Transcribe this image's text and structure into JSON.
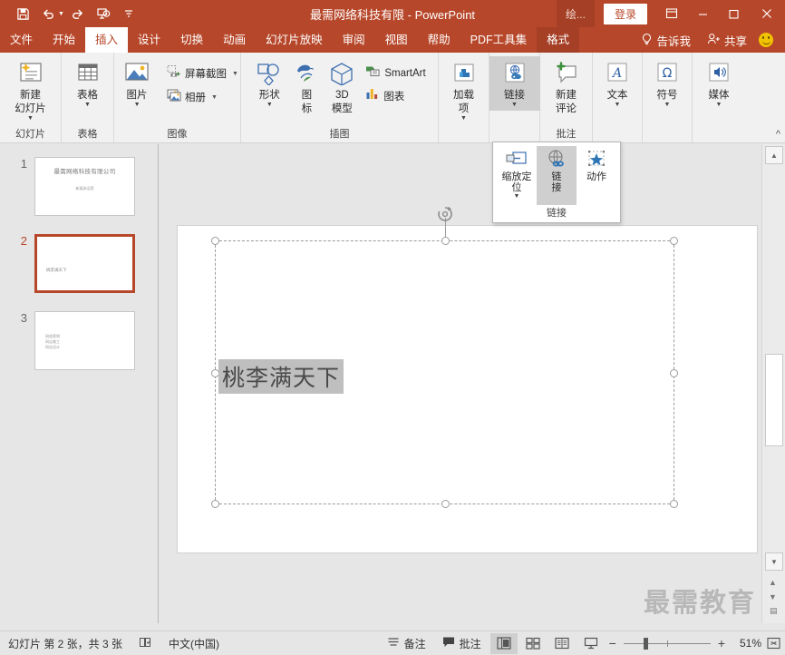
{
  "titlebar": {
    "document_title": "最需网络科技有限",
    "app_name": "PowerPoint",
    "separator": "-",
    "quick_access": [
      {
        "name": "save-icon",
        "label": "保存"
      },
      {
        "name": "undo-icon",
        "label": "撤消"
      },
      {
        "name": "redo-icon",
        "label": "恢复"
      },
      {
        "name": "start-slideshow-icon",
        "label": "从头开始"
      },
      {
        "name": "customize-qat-icon",
        "label": "自定义快速访问工具栏"
      }
    ],
    "draw_tab": "绘...",
    "signin": "登录",
    "ribbon_display": "功能区显示选项",
    "minimize": "最小化",
    "maximize": "最大化",
    "close": "关闭"
  },
  "tabs": [
    {
      "label": "文件",
      "active": false
    },
    {
      "label": "开始",
      "active": false
    },
    {
      "label": "插入",
      "active": true
    },
    {
      "label": "设计",
      "active": false
    },
    {
      "label": "切换",
      "active": false
    },
    {
      "label": "动画",
      "active": false
    },
    {
      "label": "幻灯片放映",
      "active": false
    },
    {
      "label": "审阅",
      "active": false
    },
    {
      "label": "视图",
      "active": false
    },
    {
      "label": "帮助",
      "active": false
    },
    {
      "label": "PDF工具集",
      "active": false
    },
    {
      "label": "格式",
      "active": false,
      "contextual": true
    }
  ],
  "tab_right": {
    "tellme": "告诉我",
    "share": "共享"
  },
  "ribbon": {
    "groups": [
      {
        "label": "幻灯片",
        "buttons": [
          {
            "label_line1": "新建",
            "label_line2": "幻灯片",
            "icon": "new-slide-icon",
            "dropdown": true
          }
        ]
      },
      {
        "label": "表格",
        "buttons": [
          {
            "label_line1": "表格",
            "label_line2": "",
            "icon": "table-icon",
            "dropdown": true
          }
        ]
      },
      {
        "label": "图像",
        "buttons": [
          {
            "label_line1": "图片",
            "label_line2": "",
            "icon": "picture-icon",
            "dropdown": true
          }
        ],
        "small_buttons": [
          {
            "label": "屏幕截图",
            "icon": "screenshot-icon",
            "dropdown": true
          },
          {
            "label": "相册",
            "icon": "photo-album-icon",
            "dropdown": true
          }
        ]
      },
      {
        "label": "插图",
        "buttons": [
          {
            "label_line1": "形状",
            "label_line2": "",
            "icon": "shapes-icon",
            "dropdown": true
          },
          {
            "label_line1": "图",
            "label_line2": "标",
            "icon": "icons-icon",
            "dropdown": false
          },
          {
            "label_line1": "3D",
            "label_line2": "模型",
            "icon": "model3d-icon",
            "dropdown": false
          }
        ],
        "small_buttons": [
          {
            "label": "SmartArt",
            "icon": "smartart-icon",
            "dropdown": false
          },
          {
            "label": "图表",
            "icon": "chart-icon",
            "dropdown": false
          }
        ]
      },
      {
        "label": "",
        "buttons": [
          {
            "label_line1": "加载",
            "label_line2": "项",
            "icon": "addins-icon",
            "dropdown": true
          }
        ]
      },
      {
        "label": "",
        "buttons": [
          {
            "label_line1": "链接",
            "label_line2": "",
            "icon": "link-icon",
            "dropdown": true,
            "active": true
          }
        ]
      },
      {
        "label": "批注",
        "buttons": [
          {
            "label_line1": "新建",
            "label_line2": "评论",
            "icon": "new-comment-icon",
            "dropdown": false
          }
        ]
      },
      {
        "label": "",
        "buttons": [
          {
            "label_line1": "文本",
            "label_line2": "",
            "icon": "text-icon",
            "dropdown": true
          }
        ]
      },
      {
        "label": "",
        "buttons": [
          {
            "label_line1": "符号",
            "label_line2": "",
            "icon": "symbol-icon",
            "dropdown": true
          }
        ]
      },
      {
        "label": "",
        "buttons": [
          {
            "label_line1": "媒体",
            "label_line2": "",
            "icon": "media-icon",
            "dropdown": true
          }
        ]
      }
    ],
    "collapse_label": "折叠功能区"
  },
  "link_dropdown": {
    "group_label": "链接",
    "items": [
      {
        "label_line1": "缩放定",
        "label_line2": "位",
        "icon": "zoom-position-icon",
        "dropdown": true,
        "active": false
      },
      {
        "label_line1": "链",
        "label_line2": "接",
        "icon": "link-globe-icon",
        "dropdown": false,
        "active": true
      },
      {
        "label_line1": "动作",
        "label_line2": "",
        "icon": "action-star-icon",
        "dropdown": false,
        "active": false
      }
    ]
  },
  "thumbnails": [
    {
      "number": "1",
      "selected": false,
      "title": "最需网络科技有限公司",
      "subtitle": "新媒体运营"
    },
    {
      "number": "2",
      "selected": true,
      "text": "桃李满天下"
    },
    {
      "number": "3",
      "selected": false,
      "line1": "网络营销",
      "line2": "网店美工",
      "line3": "网站设计"
    }
  ],
  "slide": {
    "text": "桃李满天下",
    "watermark": "最需教育"
  },
  "scrollbar": {
    "up": "▲",
    "down": "▼",
    "prev_slide": "上一张幻灯片",
    "next_slide": "下一张幻灯片",
    "menu": "其他"
  },
  "statusbar": {
    "slide_info": "幻灯片 第 2 张，共 3 张",
    "accessibility_icon": "accessibility-check-icon",
    "language": "中文(中国)",
    "notes": "备注",
    "comments": "批注",
    "views": [
      {
        "name": "normal-view-button",
        "label": "普通视图",
        "active": true
      },
      {
        "name": "slide-sorter-button",
        "label": "幻灯片浏览",
        "active": false
      },
      {
        "name": "reading-view-button",
        "label": "阅读视图",
        "active": false
      },
      {
        "name": "slideshow-button",
        "label": "幻灯片放映",
        "active": false
      }
    ],
    "zoom_out": "−",
    "zoom_in": "+",
    "zoom_level": "51%",
    "fit_label": "使幻灯片适应当前窗口"
  },
  "colors": {
    "brand": "#b7472a",
    "brand_dark": "#a53f25",
    "ribbon_bg": "#f1f1f1",
    "canvas_bg": "#e6e6e6",
    "accent_blue": "#2e75b6"
  }
}
